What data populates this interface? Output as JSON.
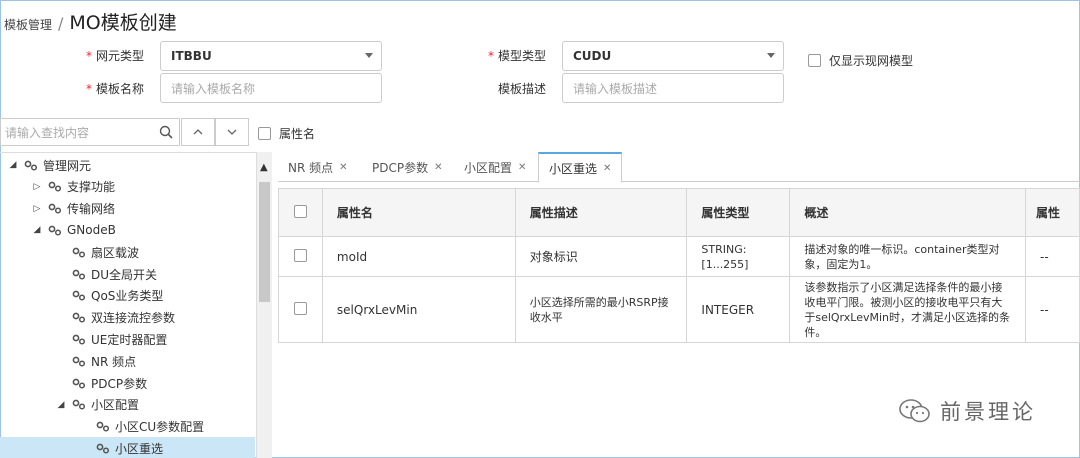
{
  "breadcrumb": {
    "parent": "模板管理",
    "separator": "/",
    "title": "MO模板创建"
  },
  "form": {
    "ne_type": {
      "label": "网元类型",
      "value": "ITBBU"
    },
    "model_type": {
      "label": "模型类型",
      "value": "CUDU"
    },
    "only_live": {
      "label": "仅显示现网模型"
    },
    "template_name": {
      "label": "模板名称",
      "placeholder": "请输入模板名称"
    },
    "template_desc": {
      "label": "模板描述",
      "placeholder": "请输入模板描述"
    }
  },
  "search": {
    "placeholder": "请输入查找内容",
    "attr_name_label": "属性名"
  },
  "tree": [
    {
      "label": "管理网元",
      "level": 0,
      "toggle": "◢"
    },
    {
      "label": "支撑功能",
      "level": 1,
      "toggle": "▷"
    },
    {
      "label": "传输网络",
      "level": 1,
      "toggle": "▷"
    },
    {
      "label": "GNodeB",
      "level": 1,
      "toggle": "◢"
    },
    {
      "label": "扇区载波",
      "level": 2,
      "toggle": ""
    },
    {
      "label": "DU全局开关",
      "level": 2,
      "toggle": ""
    },
    {
      "label": "QoS业务类型",
      "level": 2,
      "toggle": ""
    },
    {
      "label": "双连接流控参数",
      "level": 2,
      "toggle": ""
    },
    {
      "label": "UE定时器配置",
      "level": 2,
      "toggle": ""
    },
    {
      "label": "NR 频点",
      "level": 2,
      "toggle": ""
    },
    {
      "label": "PDCP参数",
      "level": 2,
      "toggle": ""
    },
    {
      "label": "小区配置",
      "level": 2,
      "toggle": "◢"
    },
    {
      "label": "小区CU参数配置",
      "level": 3,
      "toggle": ""
    },
    {
      "label": "小区重选",
      "level": 3,
      "toggle": "",
      "selected": true
    }
  ],
  "tabs": [
    {
      "label": "NR 频点"
    },
    {
      "label": "PDCP参数"
    },
    {
      "label": "小区配置"
    },
    {
      "label": "小区重选",
      "active": true
    }
  ],
  "table": {
    "headers": [
      "属性名",
      "属性描述",
      "属性类型",
      "概述",
      "属性"
    ],
    "rows": [
      {
        "name": "moId",
        "desc": "对象标识",
        "type": "STRING:\n[1...255]",
        "summary": "描述对象的唯一标识。container类型对象，固定为1。",
        "extra": "--"
      },
      {
        "name": "selQrxLevMin",
        "desc": "小区选择所需的最小RSRP接收水平",
        "type": "INTEGER",
        "summary": "该参数指示了小区满足选择条件的最小接收电平门限。被测小区的接收电平只有大于selQrxLevMin时，才满足小区选择的条件。",
        "extra": "--"
      }
    ]
  },
  "watermark": {
    "text": "前景理论"
  },
  "colors": {
    "accent": "#5aa7e0",
    "selected_row": "#cbe6f7",
    "required": "#e23333"
  },
  "icons": {
    "tree_node": "gear-icon",
    "search": "search-icon",
    "up": "chevron-up-icon",
    "down": "chevron-down-icon",
    "watermark": "wechat-icon"
  }
}
